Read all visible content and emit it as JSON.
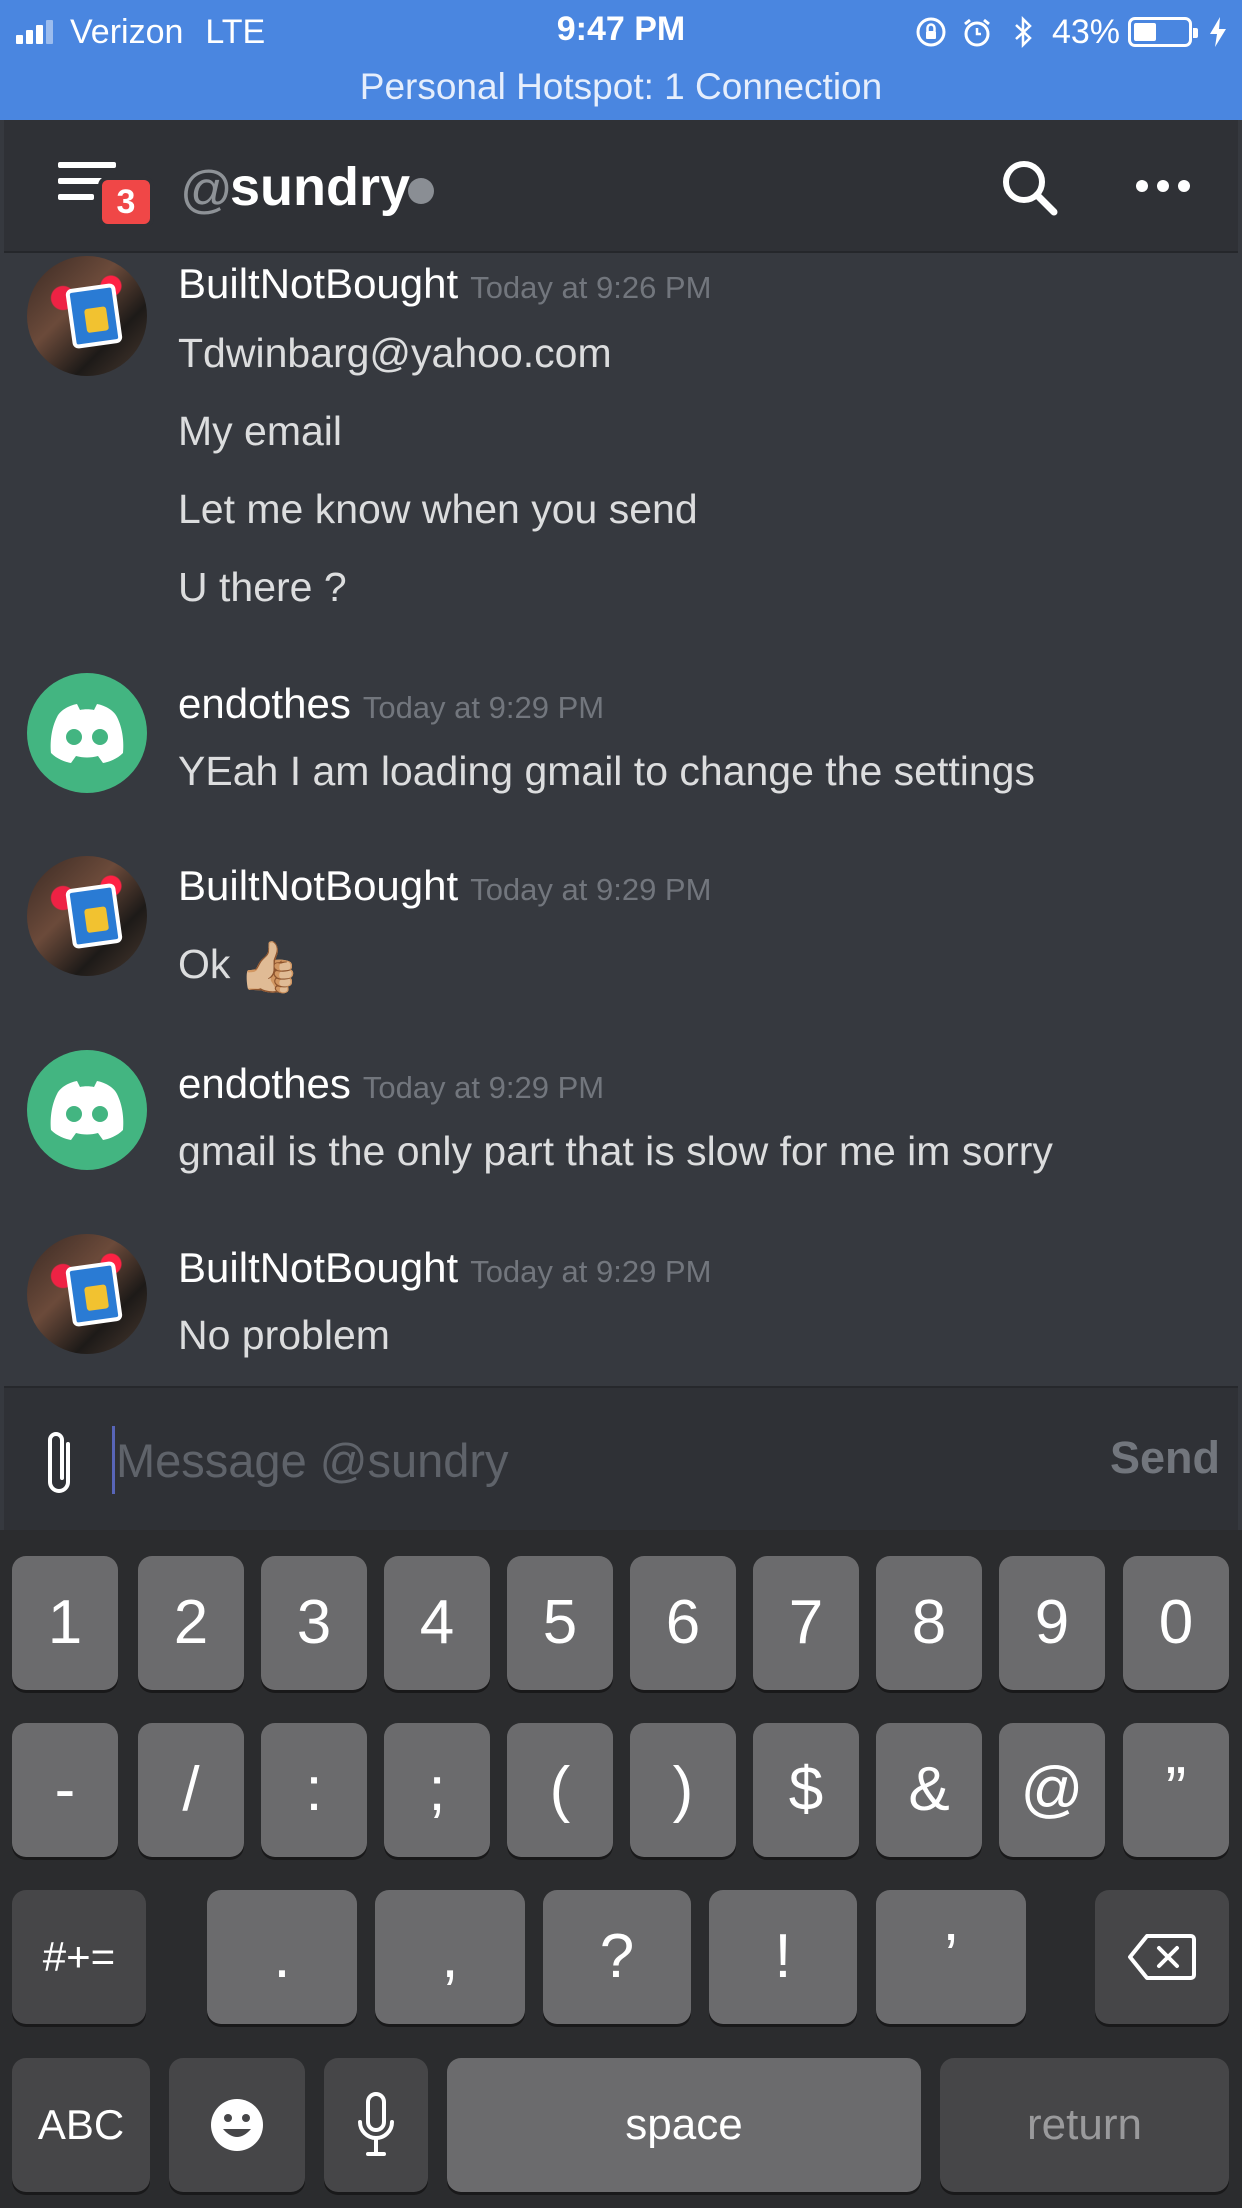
{
  "status_bar": {
    "carrier": "Verizon",
    "network": "LTE",
    "time": "9:47 PM",
    "battery": "43%",
    "battery_level": 0.43,
    "hotspot": "Personal Hotspot: 1 Connection",
    "icons": [
      "signal-icon",
      "rotation-lock-icon",
      "alarm-icon",
      "bluetooth-icon",
      "battery-icon",
      "charging-icon"
    ]
  },
  "header": {
    "menu_badge": "3",
    "at_symbol": "@",
    "channel": "sundry",
    "icons": [
      "hamburger-menu-icon",
      "presence-dot-icon",
      "search-icon",
      "more-options-icon"
    ]
  },
  "messages": [
    {
      "author": "BuiltNotBought",
      "timestamp": "Today at 9:26 PM",
      "avatar": "photo",
      "lines": [
        "Tdwinbarg@yahoo.com",
        "My email",
        "Let me know when you send",
        "U there ?"
      ]
    },
    {
      "author": "endothes",
      "timestamp": "Today at 9:29 PM",
      "avatar": "discord-logo",
      "lines": [
        "YEah I am loading gmail to change the settings"
      ]
    },
    {
      "author": "BuiltNotBought",
      "timestamp": "Today at 9:29 PM",
      "avatar": "photo",
      "lines": [
        "Ok"
      ],
      "emoji": "👍🏼"
    },
    {
      "author": "endothes",
      "timestamp": "Today at 9:29 PM",
      "avatar": "discord-logo",
      "lines": [
        "gmail is the only part that is slow for me im sorry"
      ]
    },
    {
      "author": "BuiltNotBought",
      "timestamp": "Today at 9:29 PM",
      "avatar": "photo",
      "lines": [
        "No problem"
      ]
    }
  ],
  "composer": {
    "placeholder": "Message @sundry",
    "value": "",
    "send_label": "Send",
    "attach_icon": "paperclip-icon"
  },
  "keyboard": {
    "row1": [
      "1",
      "2",
      "3",
      "4",
      "5",
      "6",
      "7",
      "8",
      "9",
      "0"
    ],
    "row2": [
      "-",
      "/",
      ":",
      ";",
      "(",
      ")",
      "$",
      "&",
      "@",
      "”"
    ],
    "row3_left": "#+=",
    "row3": [
      ".",
      ",",
      "?",
      "!",
      "’"
    ],
    "backspace_icon": "backspace-icon",
    "abc": "ABC",
    "emoji_icon": "emoji-icon",
    "mic_icon": "microphone-icon",
    "space": "space",
    "return": "return"
  }
}
